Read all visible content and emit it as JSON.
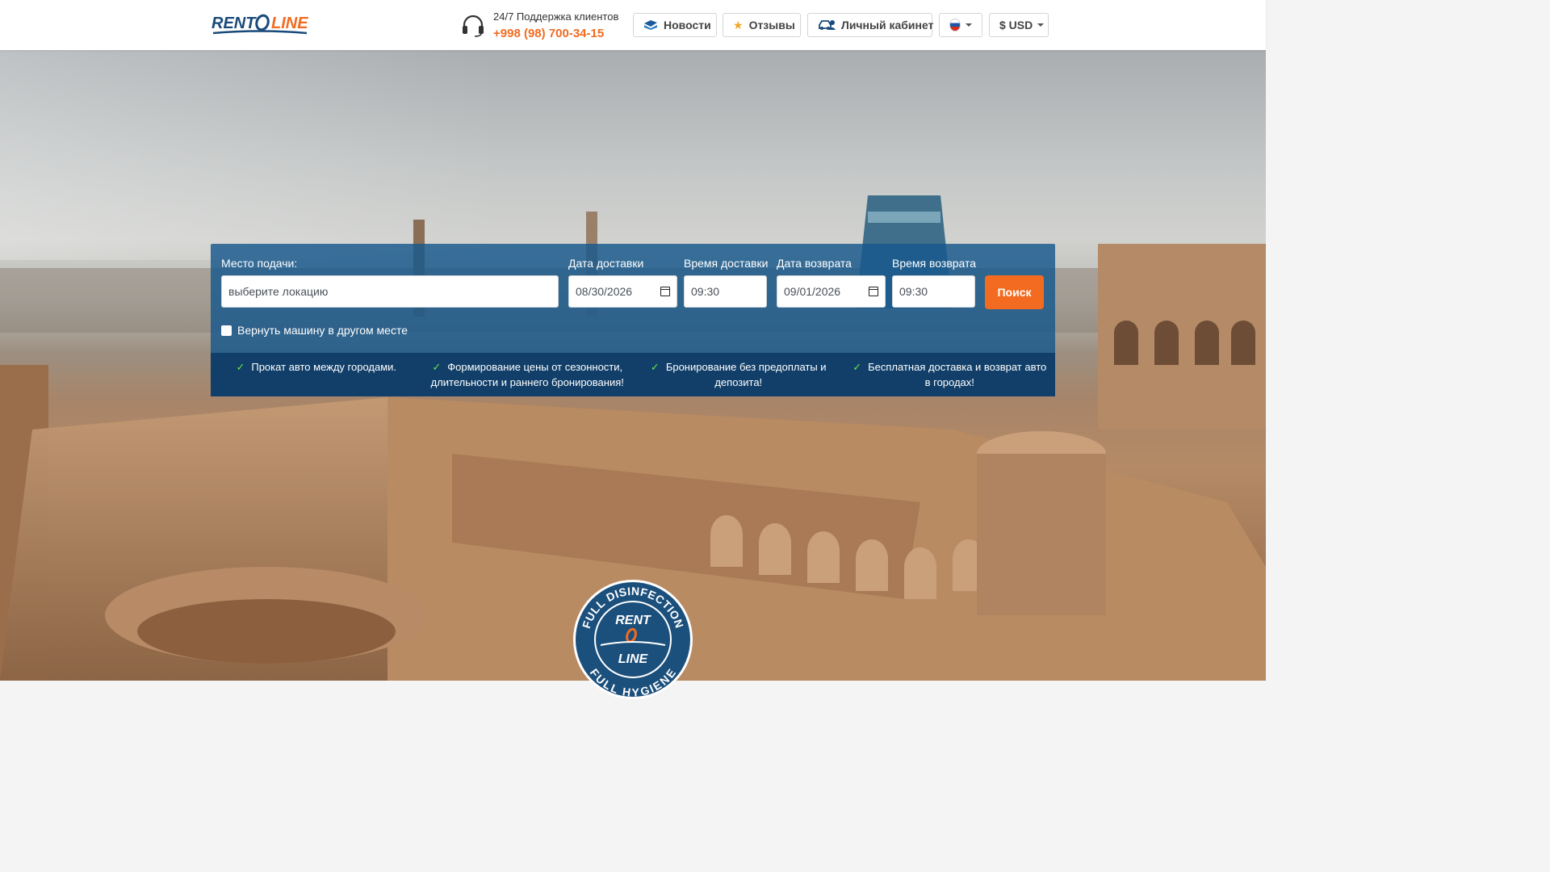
{
  "header": {
    "logo_text": "RENT LINE",
    "support_label": "24/7 Поддержка клиентов",
    "phone": "+998 (98) 700-34-15",
    "news_label": "Новости",
    "reviews_label": "Отзывы",
    "account_label": "Личный кабинет",
    "currency_label": "$ USD",
    "language": "ru"
  },
  "search": {
    "pickup_label": "Место подачи:",
    "pickup_placeholder": "выберите локацию",
    "delivery_date_label": "Дата доставки",
    "delivery_date_value": "08/30/2026",
    "delivery_time_label": "Время доставки",
    "delivery_time_value": "09:30",
    "return_date_label": "Дата возврата",
    "return_date_value": "09/01/2026",
    "return_time_label": "Время возврата",
    "return_time_value": "09:30",
    "search_button": "Поиск",
    "return_elsewhere_label": "Вернуть машину в другом месте",
    "return_elsewhere_checked": false
  },
  "features": [
    {
      "icon": "check-icon",
      "text": "Прокат авто между городами."
    },
    {
      "icon": "check-icon",
      "text": "Формирование цены от сезонности, длительности и раннего бронирования!"
    },
    {
      "icon": "check-icon",
      "text": "Бронирование без предоплаты и депозита!"
    },
    {
      "icon": "check-icon",
      "text": "Бесплатная доставка и возврат авто в городах!"
    }
  ],
  "badge": {
    "top_text": "FULL DISINFECTION",
    "bottom_text": "FULL HYGIENE",
    "center_top": "RENT",
    "center_bottom": "LINE"
  },
  "colors": {
    "accent": "#f26b21",
    "panel": "#16588c",
    "features_bar": "#113f69",
    "check": "#6be04a"
  }
}
